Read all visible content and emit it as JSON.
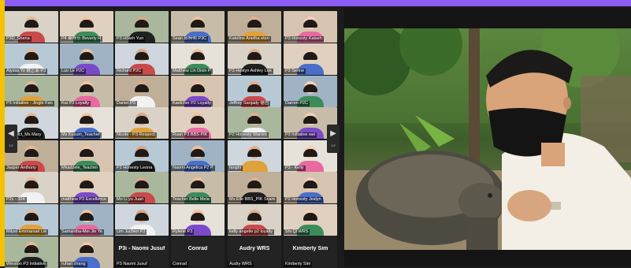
{
  "window": {
    "accent": "#8b5cf6",
    "edge_color": "#f2c200"
  },
  "gallery": {
    "prev_icon": "chevron-left-icon",
    "next_icon": "chevron-right-icon",
    "page_label": "1/2",
    "tiles": [
      {
        "name": "P3D_Shena"
      },
      {
        "name": "P4 蔡梓乐 Beverly H"
      },
      {
        "name": "P3 HSieh Yun"
      },
      {
        "name": "Sean 邱梓明 P3C"
      },
      {
        "name": "Kateline Arietha eten"
      },
      {
        "name": "P3 Honesty Kaiseh"
      },
      {
        "name": "Alyssa Yo 姚艺菲 P3"
      },
      {
        "name": "Luo Le P2C"
      },
      {
        "name": "Richard P2C"
      },
      {
        "name": "Matthew Lin Dixin P"
      },
      {
        "name": "P3 Hestyn Ashley Lee"
      },
      {
        "name": "P3 Serine"
      },
      {
        "name": "P3 Initiative - Jingle Fan"
      },
      {
        "name": "Kai P3 Loyalty"
      },
      {
        "name": "Daniel P3"
      },
      {
        "name": "Kaelcher P2 Loyalty"
      },
      {
        "name": "Jeffrey Sanjady 德哲"
      },
      {
        "name": "Darren P2C"
      },
      {
        "name": "Respect_Ms Mary"
      },
      {
        "name": "Ms Kusum_Teacher"
      },
      {
        "name": "Nicole - P3 Respect"
      },
      {
        "name": "Ruan P3 BBS PIK"
      },
      {
        "name": "P2 Honesty Warren"
      },
      {
        "name": "P3 Initiative wei"
      },
      {
        "name": "Jasper Anthony"
      },
      {
        "name": "Mkadzele_Teacher"
      },
      {
        "name": "P2 Honesty Leona"
      },
      {
        "name": "Naomi Angelica P2 P"
      },
      {
        "name": "fanghi"
      },
      {
        "name": "P3 - Kelly"
      },
      {
        "name": "P2c - 304"
      },
      {
        "name": "matthew P3 Excellence"
      },
      {
        "name": "Mo Li yu Juan"
      },
      {
        "name": "Teacher Belle Mela"
      },
      {
        "name": "Ms Elle BBS_PIK Scare"
      },
      {
        "name": "P2 Honesty Jeslyn"
      },
      {
        "name": "Mitzel Emmanuel Lie"
      },
      {
        "name": "Samantha-Mei Jie Ye"
      },
      {
        "name": "Lim Juchen P3"
      },
      {
        "name": "Rylene P3"
      },
      {
        "name": "kelly angelie p2 loyalty"
      },
      {
        "name": "Shi Qi WRS"
      },
      {
        "name": "Winston P3 Initiative"
      },
      {
        "name": "ruhan zhang"
      },
      {
        "name": "P3 Naomi Jusuf",
        "big": "P3i - Naomi Jusuf"
      },
      {
        "name": "Conrad",
        "big": "Conrad"
      },
      {
        "name": "Audry WRS",
        "big": "Audry WRS"
      },
      {
        "name": "Kimberly Sim",
        "big": "Kimberly Sim"
      }
    ]
  },
  "speaker": {
    "icons": [
      "mask-icon",
      "tortoise-icon"
    ]
  }
}
